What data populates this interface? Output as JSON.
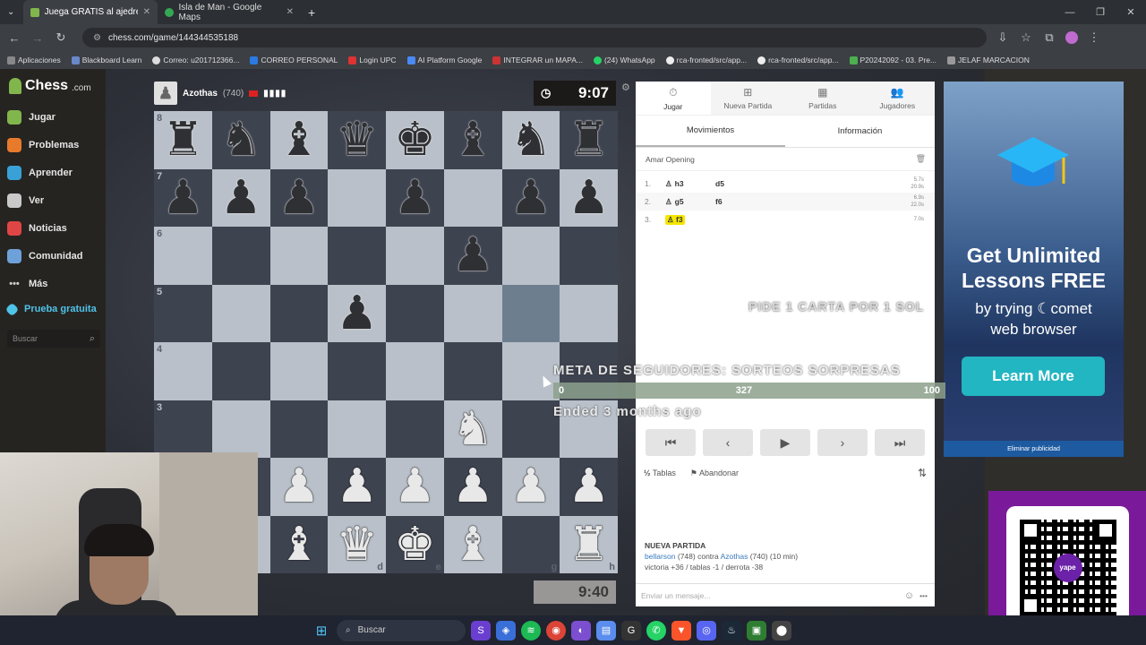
{
  "browser": {
    "tabs": [
      {
        "title": "Juega GRATIS al ajedrez online",
        "active": true
      },
      {
        "title": "Isla de Man - Google Maps",
        "active": false
      }
    ],
    "url": "chess.com/game/144344535188",
    "bookmarks": [
      "Aplicaciones",
      "Blackboard Learn",
      "Correo: u201712366...",
      "CORREO PERSONAL",
      "Login UPC",
      "AI Platform Google",
      "INTEGRAR un MAPA...",
      "(24) WhatsApp",
      "rca-fronted/src/app...",
      "rca-fronted/src/app...",
      "P20242092 - 03. Pre...",
      "JELAF MARCACION"
    ]
  },
  "sidebar": {
    "logo": "Chess",
    "logo_suffix": ".com",
    "items": [
      {
        "label": "Jugar",
        "icon": "pawn-play-icon",
        "color": "#81b64c"
      },
      {
        "label": "Problemas",
        "icon": "puzzle-icon",
        "color": "#e87a2c"
      },
      {
        "label": "Aprender",
        "icon": "learn-icon",
        "color": "#3aa0d8"
      },
      {
        "label": "Ver",
        "icon": "watch-icon",
        "color": "#c9c9c9"
      },
      {
        "label": "Noticias",
        "icon": "news-icon",
        "color": "#e04545"
      },
      {
        "label": "Comunidad",
        "icon": "community-icon",
        "color": "#6ea1d9"
      },
      {
        "label": "Más",
        "icon": "more-icon",
        "color": "#c9c9c9"
      },
      {
        "label": "Prueba gratuita",
        "icon": "diamond-icon",
        "color": "#4fc3e8"
      }
    ],
    "search_placeholder": "Buscar"
  },
  "game": {
    "opponent": {
      "name": "Azothas",
      "rating": "(740)"
    },
    "top_clock": "9:07",
    "bottom_clock": "9:40"
  },
  "board": {
    "rank_labels": [
      "8",
      "7",
      "6",
      "5",
      "4",
      "3"
    ],
    "file_labels": [
      "d",
      "e",
      "g",
      "h"
    ]
  },
  "panel": {
    "tabs": [
      {
        "label": "Jugar",
        "icon": "stopwatch-icon"
      },
      {
        "label": "Nueva Partida",
        "icon": "plus-square-icon"
      },
      {
        "label": "Partidas",
        "icon": "board-icon"
      },
      {
        "label": "Jugadores",
        "icon": "players-icon"
      }
    ],
    "subtabs": [
      "Movimientos",
      "Información"
    ],
    "opening": "Amar Opening",
    "moves": [
      {
        "num": "1.",
        "white": "h3",
        "black": "d5",
        "t1": "5.7s",
        "t2": "20.9s"
      },
      {
        "num": "2.",
        "white": "g5",
        "black": "f6",
        "t1": "6.9s",
        "t2": "22.0s"
      },
      {
        "num": "3.",
        "white": "f3",
        "black": "",
        "t1": "7.0s",
        "t2": ""
      }
    ],
    "actions": {
      "draw": "Tablas",
      "resign": "Abandonar"
    },
    "new_game": {
      "title": "NUEVA PARTIDA",
      "player1": "bellarson",
      "player1_rating": "(748)",
      "vs": "contra",
      "player2": "Azothas",
      "player2_info": "(740) (10 min)",
      "stats": "victoria +36 / tablas -1 / derrota -38"
    },
    "chat_placeholder": "Enviar un mensaje..."
  },
  "ad": {
    "headline": "Get Unlimited Lessons FREE",
    "sub": "by trying",
    "brand": "comet",
    "sub2": "web browser",
    "cta": "Learn More",
    "remove": "Eliminar publicidad"
  },
  "stream_overlay": {
    "ticker": "PIDE 1 CARTA POR 1 SOL",
    "goal_title": "META DE SEGUIDORES: SORTEOS SORPRESAS",
    "goal_min": "0",
    "goal_current": "327",
    "goal_max": "100",
    "ended": "Ended 3 months ago"
  },
  "taskbar": {
    "search": "Buscar"
  }
}
